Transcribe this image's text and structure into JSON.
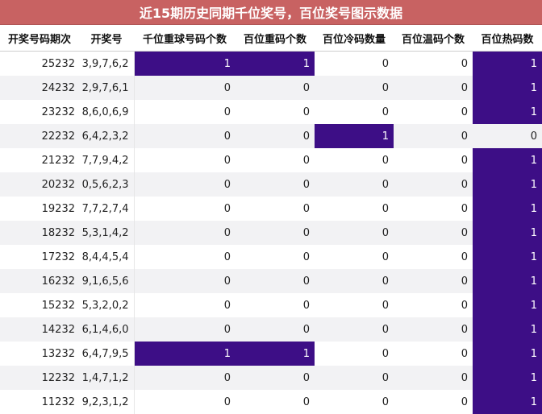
{
  "title": "近15期历史同期千位奖号，百位奖号图示数据",
  "columns": [
    "开奖号码期次",
    "开奖号",
    "千位重球号码个数",
    "百位重码个数",
    "百位冷码数量",
    "百位温码个数",
    "百位热码数"
  ],
  "highlight_color": "#3d0e86",
  "rows": [
    {
      "period": "25232",
      "numbers": "3,9,7,6,2",
      "thousands_repeat": "1",
      "hundreds_repeat": "1",
      "hundreds_cold": "0",
      "hundreds_warm": "0",
      "hundreds_hot": "1"
    },
    {
      "period": "24232",
      "numbers": "2,9,7,6,1",
      "thousands_repeat": "0",
      "hundreds_repeat": "0",
      "hundreds_cold": "0",
      "hundreds_warm": "0",
      "hundreds_hot": "1"
    },
    {
      "period": "23232",
      "numbers": "8,6,0,6,9",
      "thousands_repeat": "0",
      "hundreds_repeat": "0",
      "hundreds_cold": "0",
      "hundreds_warm": "0",
      "hundreds_hot": "1"
    },
    {
      "period": "22232",
      "numbers": "6,4,2,3,2",
      "thousands_repeat": "0",
      "hundreds_repeat": "0",
      "hundreds_cold": "1",
      "hundreds_warm": "0",
      "hundreds_hot": "0"
    },
    {
      "period": "21232",
      "numbers": "7,7,9,4,2",
      "thousands_repeat": "0",
      "hundreds_repeat": "0",
      "hundreds_cold": "0",
      "hundreds_warm": "0",
      "hundreds_hot": "1"
    },
    {
      "period": "20232",
      "numbers": "0,5,6,2,3",
      "thousands_repeat": "0",
      "hundreds_repeat": "0",
      "hundreds_cold": "0",
      "hundreds_warm": "0",
      "hundreds_hot": "1"
    },
    {
      "period": "19232",
      "numbers": "7,7,2,7,4",
      "thousands_repeat": "0",
      "hundreds_repeat": "0",
      "hundreds_cold": "0",
      "hundreds_warm": "0",
      "hundreds_hot": "1"
    },
    {
      "period": "18232",
      "numbers": "5,3,1,4,2",
      "thousands_repeat": "0",
      "hundreds_repeat": "0",
      "hundreds_cold": "0",
      "hundreds_warm": "0",
      "hundreds_hot": "1"
    },
    {
      "period": "17232",
      "numbers": "8,4,4,5,4",
      "thousands_repeat": "0",
      "hundreds_repeat": "0",
      "hundreds_cold": "0",
      "hundreds_warm": "0",
      "hundreds_hot": "1"
    },
    {
      "period": "16232",
      "numbers": "9,1,6,5,6",
      "thousands_repeat": "0",
      "hundreds_repeat": "0",
      "hundreds_cold": "0",
      "hundreds_warm": "0",
      "hundreds_hot": "1"
    },
    {
      "period": "15232",
      "numbers": "5,3,2,0,2",
      "thousands_repeat": "0",
      "hundreds_repeat": "0",
      "hundreds_cold": "0",
      "hundreds_warm": "0",
      "hundreds_hot": "1"
    },
    {
      "period": "14232",
      "numbers": "6,1,4,6,0",
      "thousands_repeat": "0",
      "hundreds_repeat": "0",
      "hundreds_cold": "0",
      "hundreds_warm": "0",
      "hundreds_hot": "1"
    },
    {
      "period": "13232",
      "numbers": "6,4,7,9,5",
      "thousands_repeat": "1",
      "hundreds_repeat": "1",
      "hundreds_cold": "0",
      "hundreds_warm": "0",
      "hundreds_hot": "1"
    },
    {
      "period": "12232",
      "numbers": "1,4,7,1,2",
      "thousands_repeat": "0",
      "hundreds_repeat": "0",
      "hundreds_cold": "0",
      "hundreds_warm": "0",
      "hundreds_hot": "1"
    },
    {
      "period": "11232",
      "numbers": "9,2,3,1,2",
      "thousands_repeat": "0",
      "hundreds_repeat": "0",
      "hundreds_cold": "0",
      "hundreds_warm": "0",
      "hundreds_hot": "1"
    }
  ]
}
